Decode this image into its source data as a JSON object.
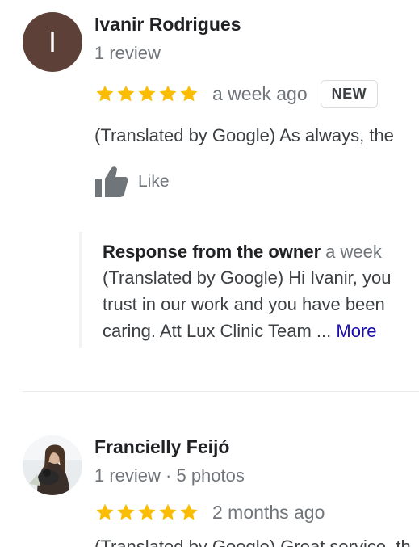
{
  "reviews": [
    {
      "name": "Ivanir Rodrigues",
      "avatar_initial": "I",
      "avatar_color": "#5d4037",
      "meta": "1 review",
      "rating": 5,
      "when": "a week ago",
      "badge": "NEW",
      "text": "(Translated by Google) As always, the",
      "like_label": "Like",
      "owner_response": {
        "title": "Response from the owner",
        "when": "a week",
        "lines": [
          "(Translated by Google) Hi Ivanir, you",
          "trust in our work and you have been",
          "caring. Att Lux Clinic Team ..."
        ],
        "more_label": "More"
      }
    },
    {
      "name": "Francielly Feijó",
      "meta": "1 review · 5 photos",
      "rating": 5,
      "when": "2 months ago",
      "text": "(Translated by Google) Great service, th"
    }
  ],
  "colors": {
    "star": "#fbbc04",
    "link": "#1a0dab",
    "avatar_bg": "#5d4037"
  }
}
